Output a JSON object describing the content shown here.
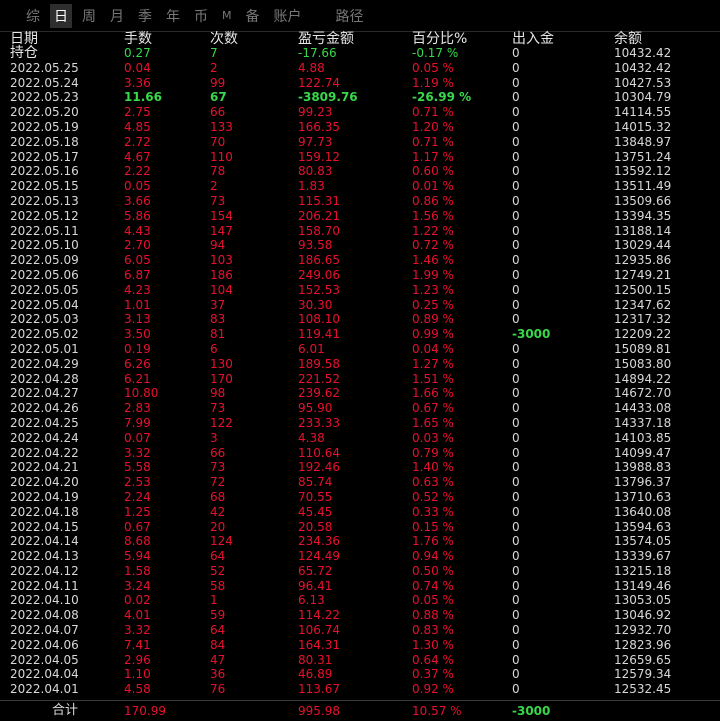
{
  "tabs": [
    {
      "label": "综",
      "active": false
    },
    {
      "label": "日",
      "active": true
    },
    {
      "label": "周",
      "active": false
    },
    {
      "label": "月",
      "active": false
    },
    {
      "label": "季",
      "active": false
    },
    {
      "label": "年",
      "active": false
    },
    {
      "label": "币",
      "active": false
    },
    {
      "label": "M",
      "active": false
    },
    {
      "label": "备",
      "active": false
    },
    {
      "label": "账户",
      "active": false
    },
    {
      "label": "路径",
      "active": false
    }
  ],
  "headers": [
    "日期",
    "手数",
    "次数",
    "盈亏金额",
    "百分比%",
    "出入金",
    "余额"
  ],
  "colors": {
    "red": "#e8112d",
    "green": "#37d84a",
    "text": "#d8d8d8",
    "background": "#000000"
  },
  "position_row": {
    "date": "持仓",
    "lots": "0.27",
    "count": "7",
    "pnl": "-17.66",
    "pct": "-0.17 %",
    "flow": "0",
    "balance": "10432.42"
  },
  "rows": [
    {
      "date": "2022.05.25",
      "lots": "0.04",
      "count": "2",
      "pnl": "4.88",
      "pct": "0.05 %",
      "flow": "0",
      "balance": "10432.42",
      "c": "red"
    },
    {
      "date": "2022.05.24",
      "lots": "3.36",
      "count": "99",
      "pnl": "122.74",
      "pct": "1.19 %",
      "flow": "0",
      "balance": "10427.53",
      "c": "red"
    },
    {
      "date": "2022.05.23",
      "lots": "11.66",
      "count": "67",
      "pnl": "-3809.76",
      "pct": "-26.99 %",
      "flow": "0",
      "balance": "10304.79",
      "c": "green"
    },
    {
      "date": "2022.05.20",
      "lots": "2.75",
      "count": "66",
      "pnl": "99.23",
      "pct": "0.71 %",
      "flow": "0",
      "balance": "14114.55",
      "c": "red"
    },
    {
      "date": "2022.05.19",
      "lots": "4.85",
      "count": "133",
      "pnl": "166.35",
      "pct": "1.20 %",
      "flow": "0",
      "balance": "14015.32",
      "c": "red"
    },
    {
      "date": "2022.05.18",
      "lots": "2.72",
      "count": "70",
      "pnl": "97.73",
      "pct": "0.71 %",
      "flow": "0",
      "balance": "13848.97",
      "c": "red"
    },
    {
      "date": "2022.05.17",
      "lots": "4.67",
      "count": "110",
      "pnl": "159.12",
      "pct": "1.17 %",
      "flow": "0",
      "balance": "13751.24",
      "c": "red"
    },
    {
      "date": "2022.05.16",
      "lots": "2.22",
      "count": "78",
      "pnl": "80.83",
      "pct": "0.60 %",
      "flow": "0",
      "balance": "13592.12",
      "c": "red"
    },
    {
      "date": "2022.05.15",
      "lots": "0.05",
      "count": "2",
      "pnl": "1.83",
      "pct": "0.01 %",
      "flow": "0",
      "balance": "13511.49",
      "c": "red"
    },
    {
      "date": "2022.05.13",
      "lots": "3.66",
      "count": "73",
      "pnl": "115.31",
      "pct": "0.86 %",
      "flow": "0",
      "balance": "13509.66",
      "c": "red"
    },
    {
      "date": "2022.05.12",
      "lots": "5.86",
      "count": "154",
      "pnl": "206.21",
      "pct": "1.56 %",
      "flow": "0",
      "balance": "13394.35",
      "c": "red"
    },
    {
      "date": "2022.05.11",
      "lots": "4.43",
      "count": "147",
      "pnl": "158.70",
      "pct": "1.22 %",
      "flow": "0",
      "balance": "13188.14",
      "c": "red"
    },
    {
      "date": "2022.05.10",
      "lots": "2.70",
      "count": "94",
      "pnl": "93.58",
      "pct": "0.72 %",
      "flow": "0",
      "balance": "13029.44",
      "c": "red"
    },
    {
      "date": "2022.05.09",
      "lots": "6.05",
      "count": "103",
      "pnl": "186.65",
      "pct": "1.46 %",
      "flow": "0",
      "balance": "12935.86",
      "c": "red"
    },
    {
      "date": "2022.05.06",
      "lots": "6.87",
      "count": "186",
      "pnl": "249.06",
      "pct": "1.99 %",
      "flow": "0",
      "balance": "12749.21",
      "c": "red"
    },
    {
      "date": "2022.05.05",
      "lots": "4.23",
      "count": "104",
      "pnl": "152.53",
      "pct": "1.23 %",
      "flow": "0",
      "balance": "12500.15",
      "c": "red"
    },
    {
      "date": "2022.05.04",
      "lots": "1.01",
      "count": "37",
      "pnl": "30.30",
      "pct": "0.25 %",
      "flow": "0",
      "balance": "12347.62",
      "c": "red"
    },
    {
      "date": "2022.05.03",
      "lots": "3.13",
      "count": "83",
      "pnl": "108.10",
      "pct": "0.89 %",
      "flow": "0",
      "balance": "12317.32",
      "c": "red"
    },
    {
      "date": "2022.05.02",
      "lots": "3.50",
      "count": "81",
      "pnl": "119.41",
      "pct": "0.99 %",
      "flow": "-3000",
      "balance": "12209.22",
      "c": "red",
      "flow_green": true
    },
    {
      "date": "2022.05.01",
      "lots": "0.19",
      "count": "6",
      "pnl": "6.01",
      "pct": "0.04 %",
      "flow": "0",
      "balance": "15089.81",
      "c": "red"
    },
    {
      "date": "2022.04.29",
      "lots": "6.26",
      "count": "130",
      "pnl": "189.58",
      "pct": "1.27 %",
      "flow": "0",
      "balance": "15083.80",
      "c": "red"
    },
    {
      "date": "2022.04.28",
      "lots": "6.21",
      "count": "170",
      "pnl": "221.52",
      "pct": "1.51 %",
      "flow": "0",
      "balance": "14894.22",
      "c": "red"
    },
    {
      "date": "2022.04.27",
      "lots": "10.80",
      "count": "98",
      "pnl": "239.62",
      "pct": "1.66 %",
      "flow": "0",
      "balance": "14672.70",
      "c": "red"
    },
    {
      "date": "2022.04.26",
      "lots": "2.83",
      "count": "73",
      "pnl": "95.90",
      "pct": "0.67 %",
      "flow": "0",
      "balance": "14433.08",
      "c": "red"
    },
    {
      "date": "2022.04.25",
      "lots": "7.99",
      "count": "122",
      "pnl": "233.33",
      "pct": "1.65 %",
      "flow": "0",
      "balance": "14337.18",
      "c": "red"
    },
    {
      "date": "2022.04.24",
      "lots": "0.07",
      "count": "3",
      "pnl": "4.38",
      "pct": "0.03 %",
      "flow": "0",
      "balance": "14103.85",
      "c": "red"
    },
    {
      "date": "2022.04.22",
      "lots": "3.32",
      "count": "66",
      "pnl": "110.64",
      "pct": "0.79 %",
      "flow": "0",
      "balance": "14099.47",
      "c": "red"
    },
    {
      "date": "2022.04.21",
      "lots": "5.58",
      "count": "73",
      "pnl": "192.46",
      "pct": "1.40 %",
      "flow": "0",
      "balance": "13988.83",
      "c": "red"
    },
    {
      "date": "2022.04.20",
      "lots": "2.53",
      "count": "72",
      "pnl": "85.74",
      "pct": "0.63 %",
      "flow": "0",
      "balance": "13796.37",
      "c": "red"
    },
    {
      "date": "2022.04.19",
      "lots": "2.24",
      "count": "68",
      "pnl": "70.55",
      "pct": "0.52 %",
      "flow": "0",
      "balance": "13710.63",
      "c": "red"
    },
    {
      "date": "2022.04.18",
      "lots": "1.25",
      "count": "42",
      "pnl": "45.45",
      "pct": "0.33 %",
      "flow": "0",
      "balance": "13640.08",
      "c": "red"
    },
    {
      "date": "2022.04.15",
      "lots": "0.67",
      "count": "20",
      "pnl": "20.58",
      "pct": "0.15 %",
      "flow": "0",
      "balance": "13594.63",
      "c": "red"
    },
    {
      "date": "2022.04.14",
      "lots": "8.68",
      "count": "124",
      "pnl": "234.36",
      "pct": "1.76 %",
      "flow": "0",
      "balance": "13574.05",
      "c": "red"
    },
    {
      "date": "2022.04.13",
      "lots": "5.94",
      "count": "64",
      "pnl": "124.49",
      "pct": "0.94 %",
      "flow": "0",
      "balance": "13339.67",
      "c": "red"
    },
    {
      "date": "2022.04.12",
      "lots": "1.58",
      "count": "52",
      "pnl": "65.72",
      "pct": "0.50 %",
      "flow": "0",
      "balance": "13215.18",
      "c": "red"
    },
    {
      "date": "2022.04.11",
      "lots": "3.24",
      "count": "58",
      "pnl": "96.41",
      "pct": "0.74 %",
      "flow": "0",
      "balance": "13149.46",
      "c": "red"
    },
    {
      "date": "2022.04.10",
      "lots": "0.02",
      "count": "1",
      "pnl": "6.13",
      "pct": "0.05 %",
      "flow": "0",
      "balance": "13053.05",
      "c": "red"
    },
    {
      "date": "2022.04.08",
      "lots": "4.01",
      "count": "59",
      "pnl": "114.22",
      "pct": "0.88 %",
      "flow": "0",
      "balance": "13046.92",
      "c": "red"
    },
    {
      "date": "2022.04.07",
      "lots": "3.32",
      "count": "64",
      "pnl": "106.74",
      "pct": "0.83 %",
      "flow": "0",
      "balance": "12932.70",
      "c": "red"
    },
    {
      "date": "2022.04.06",
      "lots": "7.41",
      "count": "84",
      "pnl": "164.31",
      "pct": "1.30 %",
      "flow": "0",
      "balance": "12823.96",
      "c": "red"
    },
    {
      "date": "2022.04.05",
      "lots": "2.96",
      "count": "47",
      "pnl": "80.31",
      "pct": "0.64 %",
      "flow": "0",
      "balance": "12659.65",
      "c": "red"
    },
    {
      "date": "2022.04.04",
      "lots": "1.10",
      "count": "36",
      "pnl": "46.89",
      "pct": "0.37 %",
      "flow": "0",
      "balance": "12579.34",
      "c": "red"
    },
    {
      "date": "2022.04.01",
      "lots": "4.58",
      "count": "76",
      "pnl": "113.67",
      "pct": "0.92 %",
      "flow": "0",
      "balance": "12532.45",
      "c": "red"
    }
  ],
  "total": {
    "label": "合计",
    "lots": "170.99",
    "pnl": "995.98",
    "pct": "10.57 %",
    "flow": "-3000"
  }
}
